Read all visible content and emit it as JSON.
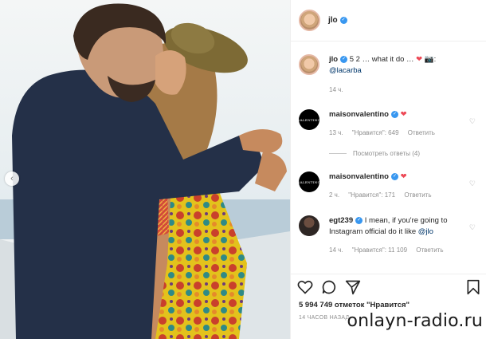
{
  "post": {
    "author": "jlo",
    "caption_text": "5 2 … what it do …",
    "caption_mention": "@lacarba",
    "caption_time": "14 ч.",
    "likes_text": "5 994 749 отметок \"Нравится\"",
    "posted_time": "14 ЧАСОВ НАЗАД"
  },
  "comments": [
    {
      "username": "maisonvalentino",
      "avatar_label": "VALENTINO",
      "time": "13 ч.",
      "likes": "\"Нравится\": 649",
      "reply": "Ответить",
      "view_replies": "Посмотреть ответы (4)"
    },
    {
      "username": "maisonvalentino",
      "avatar_label": "VALENTINO",
      "time": "2 ч.",
      "likes": "\"Нравится\": 171",
      "reply": "Ответить"
    },
    {
      "username": "egt239",
      "text": "I mean, if you're going to Instagram official do it like",
      "mention": "@jlo",
      "time": "14 ч.",
      "likes": "\"Нравится\": 11 109",
      "reply": "Ответить"
    }
  ],
  "icons": [
    "heart-icon",
    "comment-icon",
    "share-icon",
    "bookmark-icon",
    "chevron-left-icon",
    "camera-emoji-icon"
  ],
  "colors": {
    "verified": "#3897f0",
    "link": "#00376b",
    "heart": "#ed4956",
    "muted": "#8e8e8e"
  },
  "watermark": "onlayn-radio.ru"
}
